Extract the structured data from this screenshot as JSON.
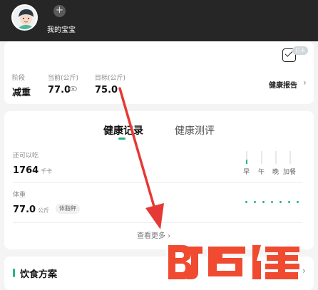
{
  "header": {
    "baby_label": "我的宝宝",
    "add_glyph": "+"
  },
  "summary": {
    "calendar_badge": "打卡",
    "stats": [
      {
        "label": "阶段",
        "value": "减重"
      },
      {
        "label": "当前(公斤)",
        "value": "77.0"
      },
      {
        "label": "目标(公斤)",
        "value": "75.0"
      }
    ],
    "report_label": "健康报告",
    "chevron": "›"
  },
  "records": {
    "tabs": [
      {
        "label": "健康记录",
        "active": true
      },
      {
        "label": "健康测评",
        "active": false
      }
    ],
    "calories": {
      "label": "还可以吃",
      "value": "1764",
      "unit": "千卡",
      "meals": [
        {
          "label": "早",
          "fill": 0.35
        },
        {
          "label": "午",
          "fill": 0
        },
        {
          "label": "晚",
          "fill": 0
        },
        {
          "label": "加餐",
          "fill": 0
        }
      ]
    },
    "weight": {
      "label": "体重",
      "value": "77.0",
      "unit": "公斤",
      "chip": "体脂秤",
      "trend_points": 7
    },
    "more_label": "查看更多",
    "more_chevron": "›"
  },
  "diet": {
    "title": "饮食方案",
    "chevron": "›"
  },
  "overlay": {
    "watermark_text": "百佳",
    "accent_color": "#27b38a",
    "arrow_color": "#e53935"
  }
}
